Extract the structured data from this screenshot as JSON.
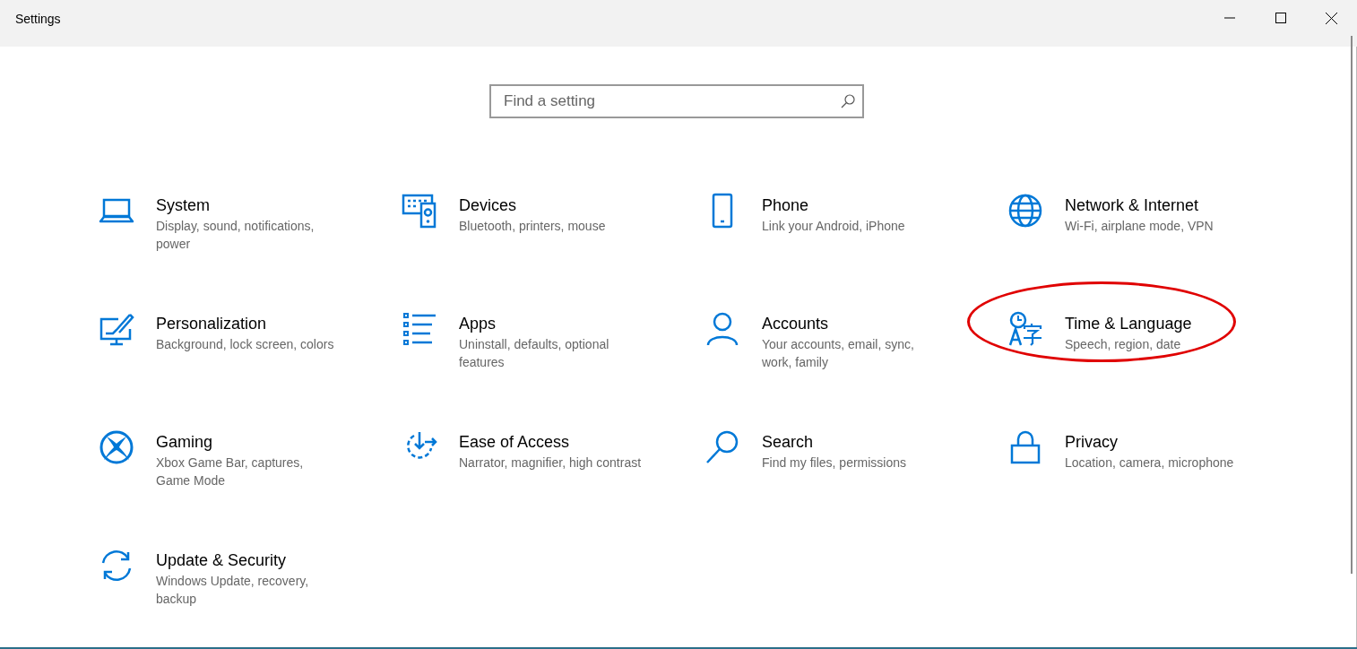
{
  "window": {
    "title": "Settings"
  },
  "search": {
    "placeholder": "Find a setting"
  },
  "categories": [
    {
      "title": "System",
      "description": "Display, sound, notifications, power",
      "circled": false
    },
    {
      "title": "Devices",
      "description": "Bluetooth, printers, mouse",
      "circled": false
    },
    {
      "title": "Phone",
      "description": "Link your Android, iPhone",
      "circled": false
    },
    {
      "title": "Network & Internet",
      "description": "Wi-Fi, airplane mode, VPN",
      "circled": false
    },
    {
      "title": "Personalization",
      "description": "Background, lock screen, colors",
      "circled": false
    },
    {
      "title": "Apps",
      "description": "Uninstall, defaults, optional features",
      "circled": false
    },
    {
      "title": "Accounts",
      "description": "Your accounts, email, sync, work, family",
      "circled": false
    },
    {
      "title": "Time & Language",
      "description": "Speech, region, date",
      "circled": true
    },
    {
      "title": "Gaming",
      "description": "Xbox Game Bar, captures, Game Mode",
      "circled": false
    },
    {
      "title": "Ease of Access",
      "description": "Narrator, magnifier, high contrast",
      "circled": false
    },
    {
      "title": "Search",
      "description": "Find my files, permissions",
      "circled": false
    },
    {
      "title": "Privacy",
      "description": "Location, camera, microphone",
      "circled": false
    },
    {
      "title": "Update & Security",
      "description": "Windows Update, recovery, backup",
      "circled": false
    }
  ]
}
